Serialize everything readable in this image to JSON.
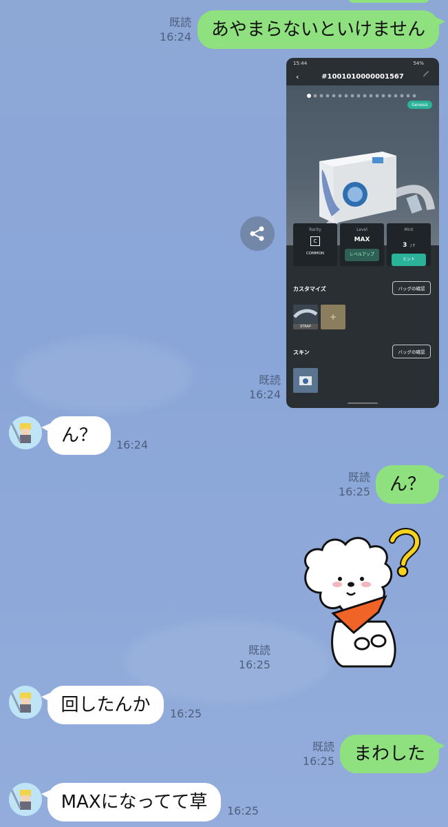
{
  "messages": {
    "m1": {
      "text": "あやまらないといけません",
      "read": "既読",
      "time": "16:24"
    },
    "m2": {
      "read": "既読",
      "time": "16:24"
    },
    "m3": {
      "text": "ん？",
      "time": "16:24"
    },
    "m4": {
      "text": "ん？",
      "read": "既読",
      "time": "16:25"
    },
    "m5": {
      "read": "既読",
      "time": "16:25"
    },
    "m6": {
      "text": "回したんか",
      "time": "16:25"
    },
    "m7": {
      "text": "まわした",
      "read": "既読",
      "time": "16:25"
    },
    "m8": {
      "text": "MAXになってて草",
      "time": "16:25"
    }
  },
  "screenshot": {
    "status_time": "15:44",
    "status_right": "54%",
    "title": "#1001010000001567",
    "badge": "Genesis",
    "rarity_label": "Rarity",
    "rarity_icon": "C",
    "rarity_value": "COMMON",
    "level_label": "Level",
    "level_value": "MAX",
    "level_button": "レベルアップ",
    "mint_label": "Mint",
    "mint_value": "3",
    "mint_max": "/ 7",
    "mint_button": "ミント",
    "customize_label": "カスタマイズ",
    "customize_button": "バッグの確認",
    "strap_label": "STRAP",
    "skin_label": "スキン",
    "skin_button": "バッグの確認"
  },
  "icons": {
    "share": "share-icon",
    "sticker": "white-dog-question-sticker",
    "avatar": "pixel-hero-avatar"
  },
  "colors": {
    "outgoing_bubble": "#8fe07f",
    "incoming_bubble": "#ffffff",
    "background": "#8ea8d6",
    "accent_mint": "#2bb39a"
  }
}
